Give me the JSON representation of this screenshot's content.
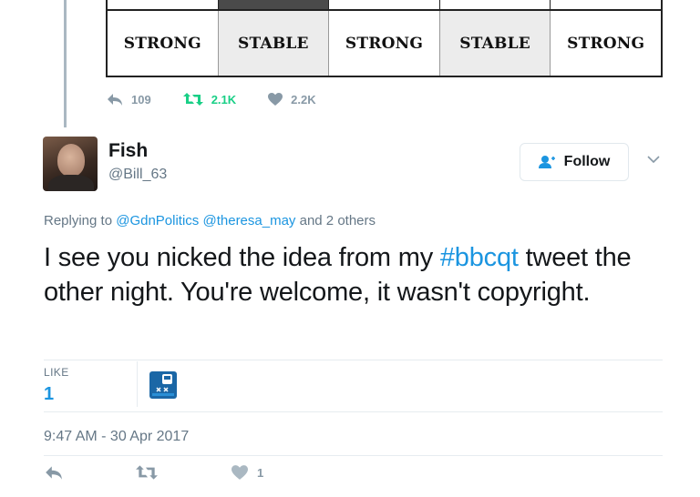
{
  "quoted_image": {
    "cells": [
      "STRONG",
      "STABLE",
      "STRONG",
      "STABLE",
      "STRONG"
    ]
  },
  "prev_tweet_actions": {
    "replies": "109",
    "retweets": "2.1K",
    "likes": "2.2K"
  },
  "tweet": {
    "author_name": "Fish",
    "author_handle": "@Bill_63",
    "follow_label": "Follow",
    "replying_prefix": "Replying to",
    "replying_user1": "@GdnPolitics",
    "replying_user2": "@theresa_may",
    "replying_suffix": "and 2 others",
    "text_part1": "I see you nicked the idea from my ",
    "hashtag": "#bbcqt",
    "text_part2": " tweet the other night. You're welcome, it wasn't copyright.",
    "likes_label": "LIKE",
    "likes_count": "1",
    "timestamp": "9:47 AM - 30 Apr 2017",
    "action_like_count": "1"
  },
  "colors": {
    "accent": "#1b95e0",
    "retweet": "#19cf86",
    "muted": "#657786"
  }
}
